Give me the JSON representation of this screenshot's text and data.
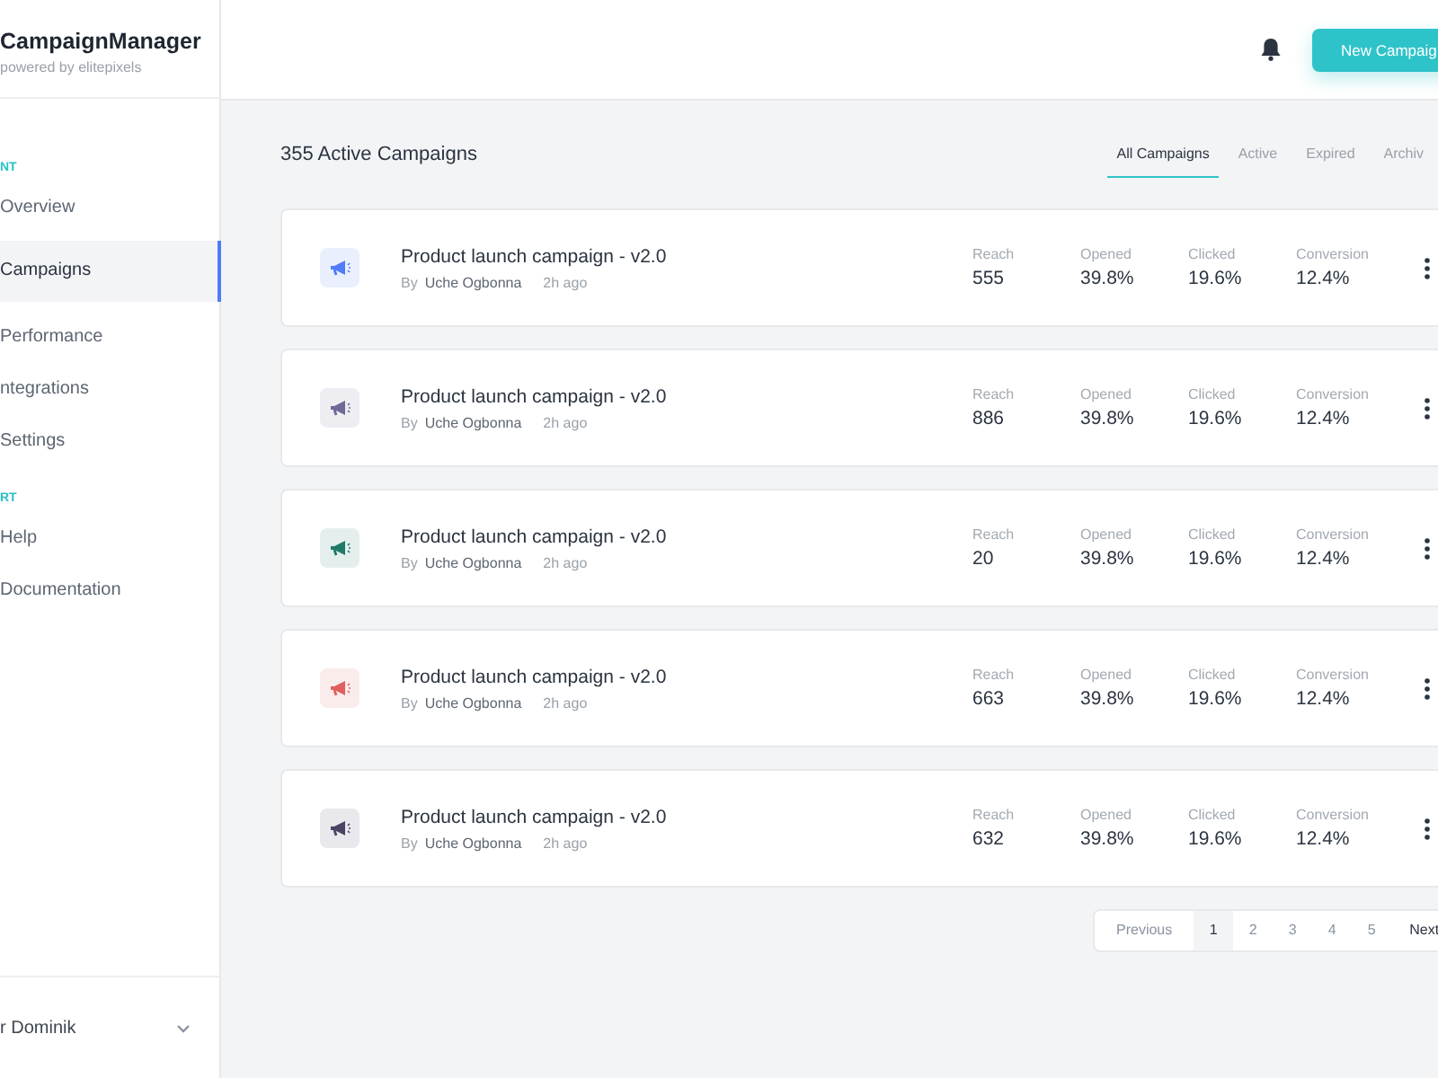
{
  "sidebar": {
    "brand": "CampaignManager",
    "tagline": "powered by elitepixels",
    "sections": [
      {
        "label": "NT",
        "items": [
          {
            "label": "Overview",
            "selected": false
          },
          {
            "label": "Campaigns",
            "selected": true
          },
          {
            "label": "Performance",
            "selected": false
          },
          {
            "label": "ntegrations",
            "selected": false
          },
          {
            "label": "Settings",
            "selected": false
          }
        ]
      },
      {
        "label": "RT",
        "items": [
          {
            "label": "Help",
            "selected": false
          },
          {
            "label": "Documentation",
            "selected": false
          }
        ]
      }
    ],
    "user": "r Dominik"
  },
  "header": {
    "button": "New Campaig"
  },
  "title": "355 Active Campaigns",
  "tabs": [
    {
      "label": "All Campaigns",
      "selected": true
    },
    {
      "label": "Active",
      "selected": false
    },
    {
      "label": "Expired",
      "selected": false
    },
    {
      "label": "Archiv",
      "selected": false
    }
  ],
  "campaigns": [
    {
      "name": "Product launch campaign - v2.0",
      "by": "By",
      "author": "Uche Ogbonna",
      "time": "2h ago",
      "color": "#4f7cf7",
      "stats": [
        {
          "label": "Reach",
          "value": "555"
        },
        {
          "label": "Opened",
          "value": "39.8%"
        },
        {
          "label": "Clicked",
          "value": "19.6%"
        },
        {
          "label": "Conversion",
          "value": "12.4%"
        }
      ]
    },
    {
      "name": "Product launch campaign - v2.0",
      "by": "By",
      "author": "Uche Ogbonna",
      "time": "2h ago",
      "color": "#6c6a96",
      "stats": [
        {
          "label": "Reach",
          "value": "886"
        },
        {
          "label": "Opened",
          "value": "39.8%"
        },
        {
          "label": "Clicked",
          "value": "19.6%"
        },
        {
          "label": "Conversion",
          "value": "12.4%"
        }
      ]
    },
    {
      "name": "Product launch campaign - v2.0",
      "by": "By",
      "author": "Uche Ogbonna",
      "time": "2h ago",
      "color": "#1f7a6a",
      "stats": [
        {
          "label": "Reach",
          "value": "20"
        },
        {
          "label": "Opened",
          "value": "39.8%"
        },
        {
          "label": "Clicked",
          "value": "19.6%"
        },
        {
          "label": "Conversion",
          "value": "12.4%"
        }
      ]
    },
    {
      "name": "Product launch campaign - v2.0",
      "by": "By",
      "author": "Uche Ogbonna",
      "time": "2h ago",
      "color": "#e0605f",
      "stats": [
        {
          "label": "Reach",
          "value": "663"
        },
        {
          "label": "Opened",
          "value": "39.8%"
        },
        {
          "label": "Clicked",
          "value": "19.6%"
        },
        {
          "label": "Conversion",
          "value": "12.4%"
        }
      ]
    },
    {
      "name": "Product launch campaign - v2.0",
      "by": "By",
      "author": "Uche Ogbonna",
      "time": "2h ago",
      "color": "#4d4363",
      "stats": [
        {
          "label": "Reach",
          "value": "632"
        },
        {
          "label": "Opened",
          "value": "39.8%"
        },
        {
          "label": "Clicked",
          "value": "19.6%"
        },
        {
          "label": "Conversion",
          "value": "12.4%"
        }
      ]
    }
  ],
  "pagination": {
    "previous": "Previous",
    "pages": [
      {
        "label": "1",
        "selected": true
      },
      {
        "label": "2",
        "selected": false
      },
      {
        "label": "3",
        "selected": false
      },
      {
        "label": "4",
        "selected": false
      },
      {
        "label": "5",
        "selected": false
      }
    ],
    "next": "Next"
  }
}
